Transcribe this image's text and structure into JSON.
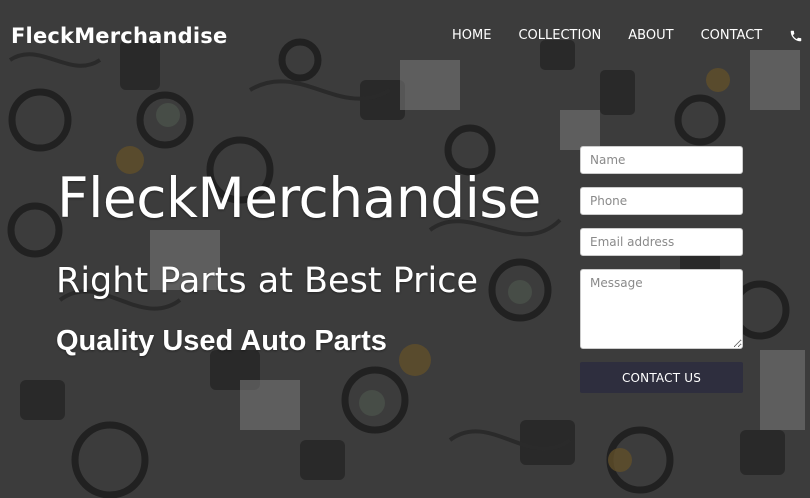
{
  "site": {
    "brand": "FleckMerchandise"
  },
  "nav": {
    "items": [
      "HOME",
      "COLLECTION",
      "ABOUT",
      "CONTACT"
    ],
    "phone_icon": "phone-icon"
  },
  "hero": {
    "title": "FleckMerchandise",
    "subtitle": "Right Parts at Best Price",
    "tagline": "Quality Used Auto Parts"
  },
  "contact_form": {
    "name_placeholder": "Name",
    "phone_placeholder": "Phone",
    "email_placeholder": "Email address",
    "message_placeholder": "Message",
    "submit_label": "CONTACT US"
  },
  "colors": {
    "button_bg": "#2e2e3e",
    "text": "#ffffff"
  }
}
